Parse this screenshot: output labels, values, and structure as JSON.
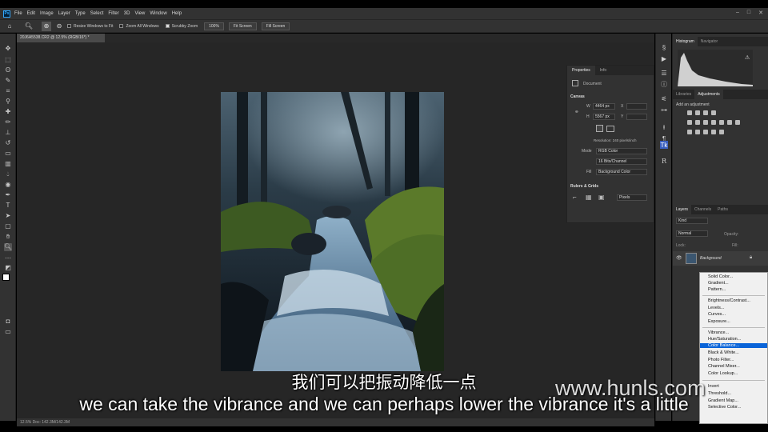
{
  "app": {
    "logo": "Ps"
  },
  "menu": [
    "File",
    "Edit",
    "Image",
    "Layer",
    "Type",
    "Select",
    "Filter",
    "3D",
    "View",
    "Window",
    "Help"
  ],
  "window_controls": [
    "–",
    "□",
    "✕"
  ],
  "options": {
    "resize_windows": "Resize Windows to Fit",
    "zoom_all": "Zoom All Windows",
    "scrubby_zoom": "Scrubby Zoom",
    "btn_100": "100%",
    "btn_fit": "Fit Screen",
    "btn_fill": "Fill Screen"
  },
  "doc_tab": "20J6A5538.CR2 @ 12.5% (RGB/16*) *",
  "properties": {
    "tab1": "Properties",
    "tab2": "Info",
    "doc_label": "Document",
    "canvas_title": "Canvas",
    "w_label": "W",
    "w_value": "4464 px",
    "h_label": "H",
    "h_value": "5567 px",
    "x_label": "X",
    "y_label": "Y",
    "resolution": "Resolution: 240 pixels/inch",
    "mode_label": "Mode",
    "mode_value": "RGB Color",
    "depth_value": "16 Bits/Channel",
    "fill_label": "Fill",
    "fill_value": "Background Color",
    "rulers_title": "Rulers & Grids",
    "units_value": "Pixels"
  },
  "right": {
    "hist_tab": "Histogram",
    "nav_tab": "Navigator",
    "lib_tab": "Libraries",
    "adj_tab": "Adjustments",
    "add_adj": "Add an adjustment",
    "layers_tab": "Layers",
    "channels_tab": "Channels",
    "paths_tab": "Paths",
    "kind": "Kind",
    "normal": "Normal",
    "opacity": "Opacity:",
    "lock": "Lock:",
    "fill": "Fill:",
    "layer_name": "Background"
  },
  "adj_menu": [
    "Solid Color...",
    "Gradient...",
    "Pattern...",
    "Brightness/Contrast...",
    "Levels...",
    "Curves...",
    "Exposure...",
    "Vibrance...",
    "Hue/Saturation...",
    "Color Balance...",
    "Black & White...",
    "Photo Filter...",
    "Channel Mixer...",
    "Color Lookup...",
    "Invert",
    "Threshold...",
    "Gradient Map...",
    "Selective Color..."
  ],
  "adj_menu_highlight": "Color Balance...",
  "status": "12.5%   Doc: 142.3M/142.3M",
  "subtitle_zh": "我们可以把振动降低一点",
  "subtitle_en": "we can take the vibrance and we can perhaps lower the vibrance it's a little",
  "watermark": "www.hunls.com",
  "colors": {
    "accent": "#0a64d8",
    "panel": "#323232",
    "canvas": "#262626"
  }
}
